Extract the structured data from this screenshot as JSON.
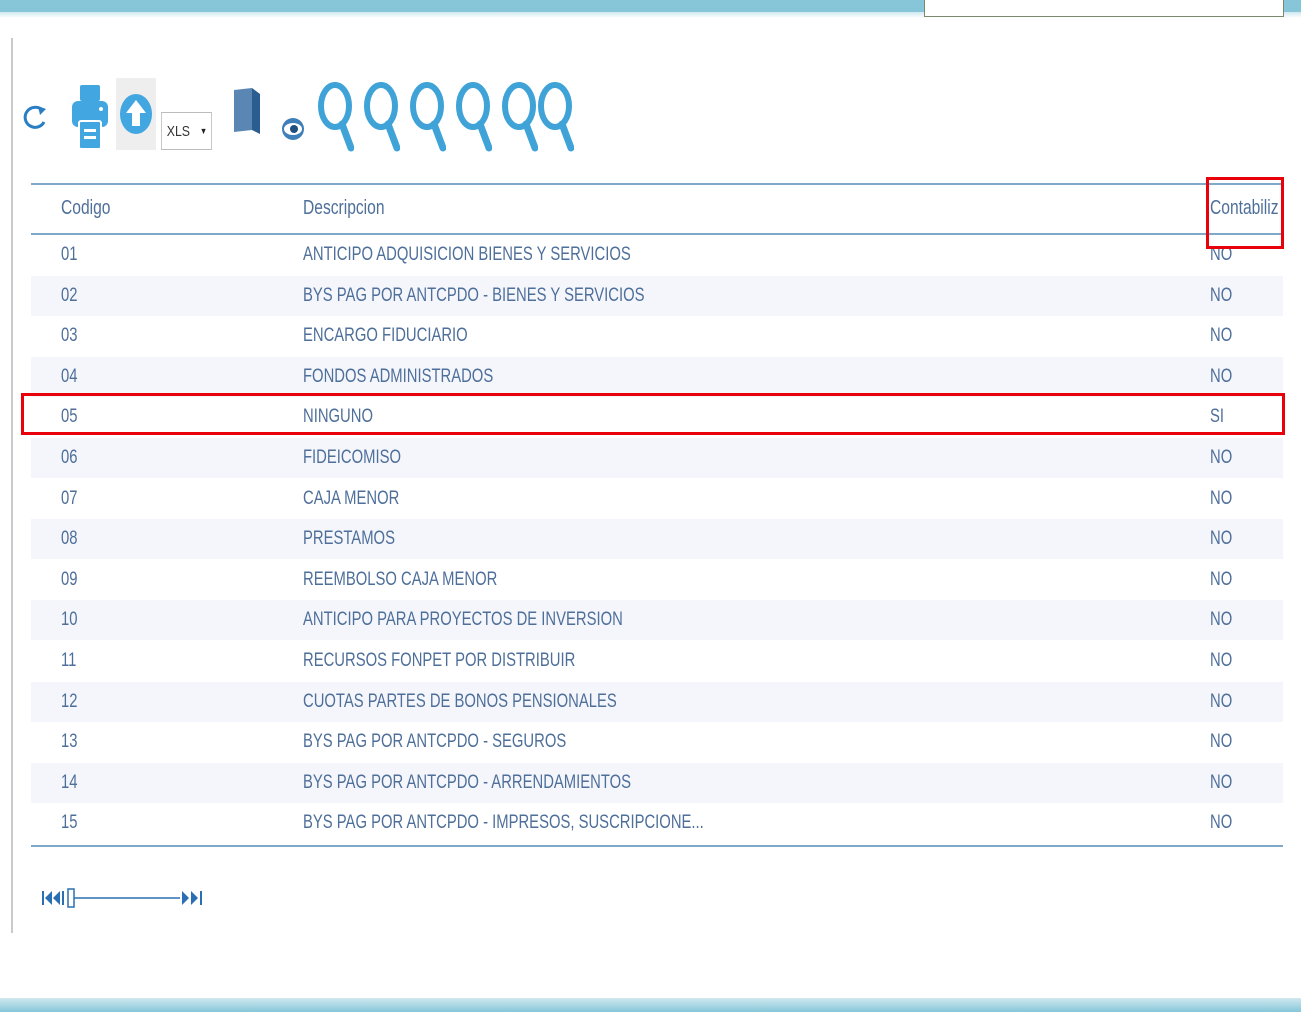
{
  "toolbar": {
    "icons": [
      "refresh-icon",
      "print-icon",
      "upload-icon",
      "export-icon",
      "view-icon",
      "search-icon"
    ],
    "export_format": "XLS",
    "search_buttons": 6
  },
  "grid": {
    "headers": {
      "codigo": "Codigo",
      "descripcion": "Descripcion",
      "contabiliza": "Contabiliz"
    },
    "rows": [
      {
        "codigo": "01",
        "descripcion": "ANTICIPO ADQUISICION BIENES Y SERVICIOS",
        "contabiliza": "NO"
      },
      {
        "codigo": "02",
        "descripcion": "BYS PAG POR ANTCPDO - BIENES Y SERVICIOS",
        "contabiliza": "NO"
      },
      {
        "codigo": "03",
        "descripcion": "ENCARGO FIDUCIARIO",
        "contabiliza": "NO"
      },
      {
        "codigo": "04",
        "descripcion": "FONDOS ADMINISTRADOS",
        "contabiliza": "NO"
      },
      {
        "codigo": "05",
        "descripcion": "NINGUNO",
        "contabiliza": "SI"
      },
      {
        "codigo": "06",
        "descripcion": "FIDEICOMISO",
        "contabiliza": "NO"
      },
      {
        "codigo": "07",
        "descripcion": "CAJA MENOR",
        "contabiliza": "NO"
      },
      {
        "codigo": "08",
        "descripcion": "PRESTAMOS",
        "contabiliza": "NO"
      },
      {
        "codigo": "09",
        "descripcion": "REEMBOLSO CAJA MENOR",
        "contabiliza": "NO"
      },
      {
        "codigo": "10",
        "descripcion": "ANTICIPO PARA PROYECTOS DE INVERSION",
        "contabiliza": "NO"
      },
      {
        "codigo": "11",
        "descripcion": "RECURSOS FONPET POR DISTRIBUIR",
        "contabiliza": "NO"
      },
      {
        "codigo": "12",
        "descripcion": "CUOTAS PARTES DE BONOS PENSIONALES",
        "contabiliza": "NO"
      },
      {
        "codigo": "13",
        "descripcion": "BYS PAG POR ANTCPDO - SEGUROS",
        "contabiliza": "NO"
      },
      {
        "codigo": "14",
        "descripcion": "BYS PAG POR ANTCPDO - ARRENDAMIENTOS",
        "contabiliza": "NO"
      },
      {
        "codigo": "15",
        "descripcion": "BYS PAG POR ANTCPDO - IMPRESOS, SUSCRIPCIONE...",
        "contabiliza": "NO"
      }
    ]
  },
  "highlights": [
    "contabiliza-header",
    "row-05"
  ],
  "colors": {
    "accent": "#3fa3d8",
    "text": "#4e6f9a",
    "highlight": "#e8000b",
    "frame": "#86c6d8"
  }
}
